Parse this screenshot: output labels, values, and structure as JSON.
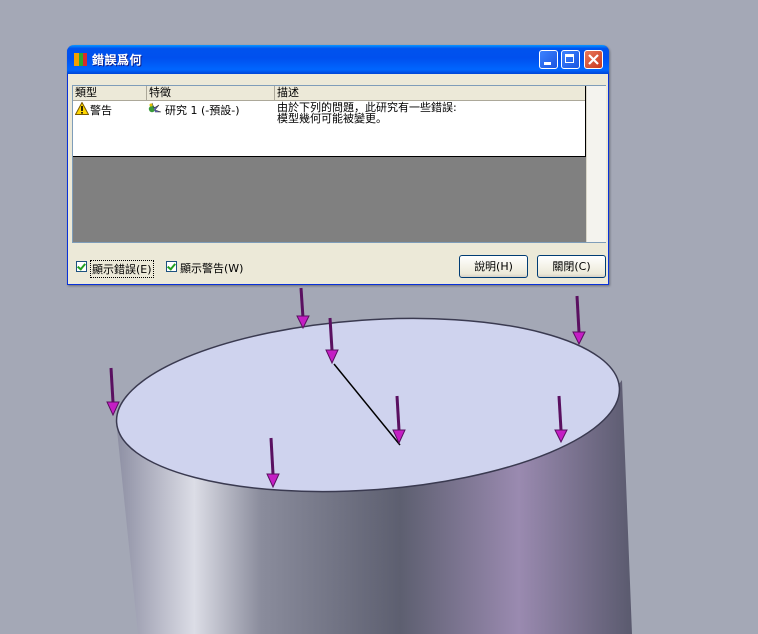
{
  "colors": {
    "desktop_bg": "#a4a8b6",
    "titlebar": "#0050ee",
    "dialog_face": "#ece9d8",
    "arrow": "#7a1a7a"
  },
  "dialog": {
    "title": "錯誤爲何",
    "title_icon": "colorful-book-icon",
    "list": {
      "headers": [
        "類型",
        "特徵",
        "描述"
      ],
      "rows": [
        {
          "type_icon": "warning-icon",
          "type": "警告",
          "feature_icon": "study-icon",
          "feature": "研究 1 (-預設-)",
          "description_line1": "由於下列的問題，此研究有一些錯誤:",
          "description_line2": "模型幾何可能被變更。"
        }
      ]
    },
    "show_errors": {
      "label": "顯示錯誤(E)",
      "checked": true
    },
    "show_warnings": {
      "label": "顯示警告(W)",
      "checked": true
    },
    "help_button": "說明(H)",
    "close_button": "關閉(C)"
  }
}
